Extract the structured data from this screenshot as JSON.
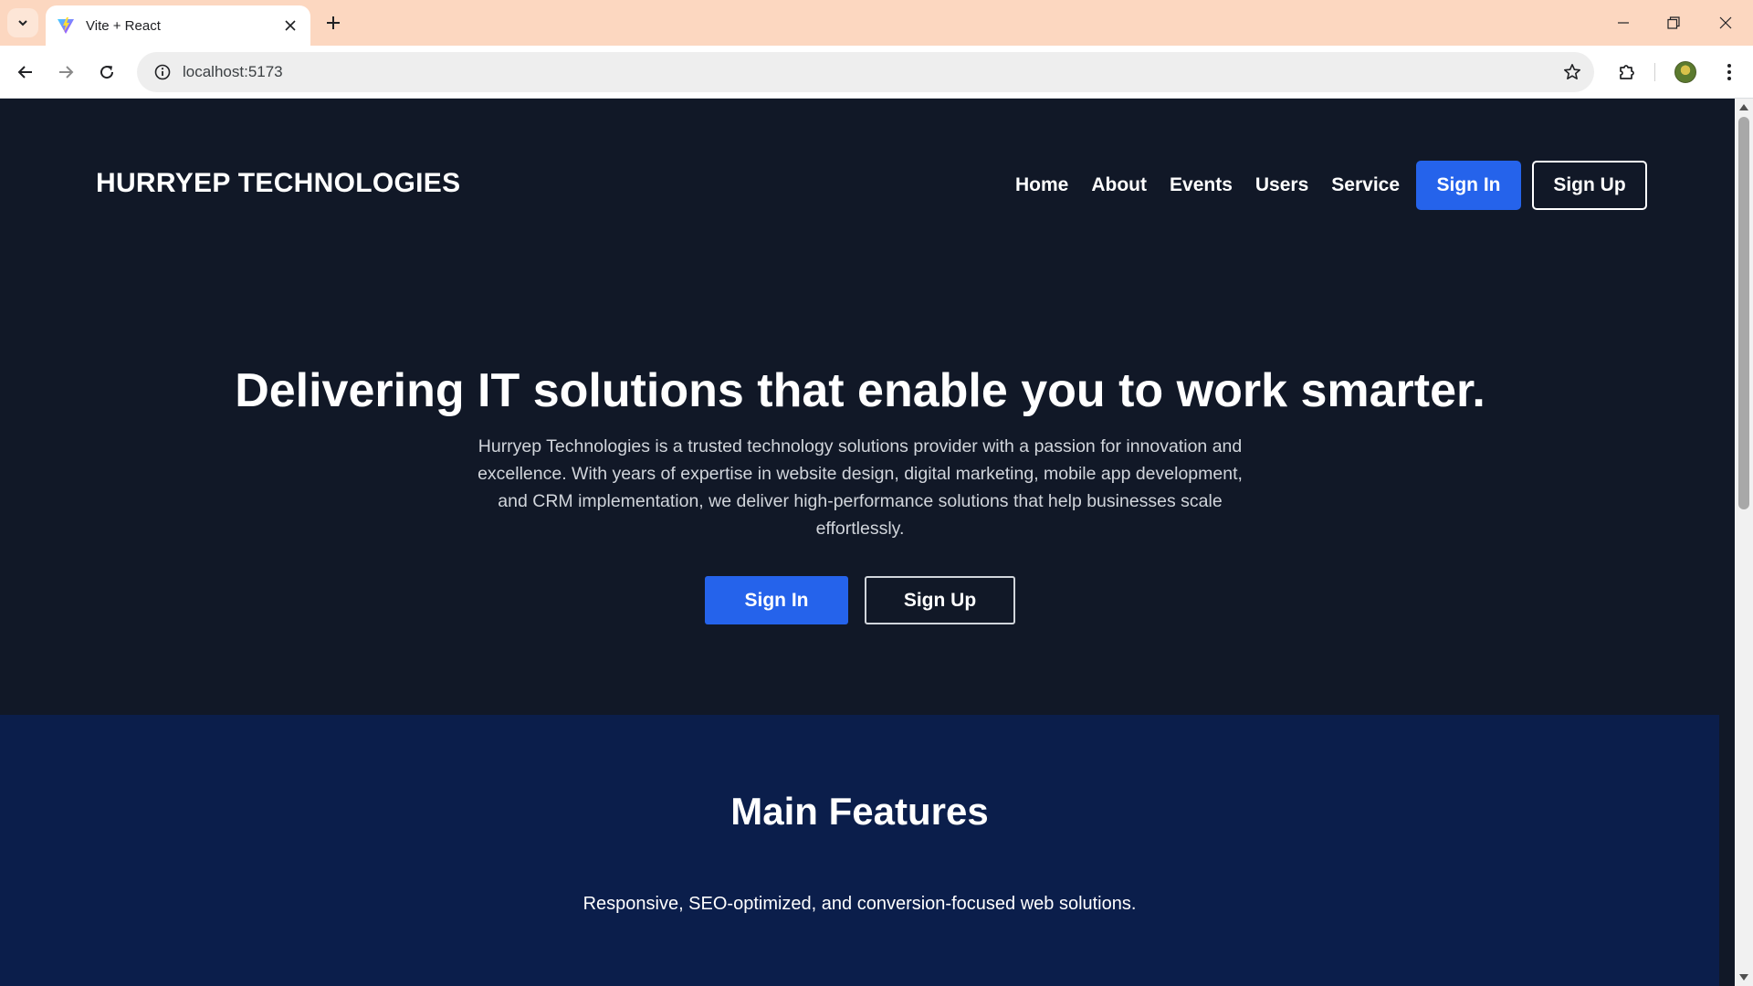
{
  "browser": {
    "tab_title": "Vite + React",
    "url": "localhost:5173"
  },
  "site": {
    "logo": "HURRYEP TECHNOLOGIES",
    "nav": [
      "Home",
      "About",
      "Events",
      "Users",
      "Service"
    ],
    "nav_signin": "Sign In",
    "nav_signup": "Sign Up"
  },
  "hero": {
    "title": "Delivering IT solutions that enable you to work smarter.",
    "description": "Hurryep Technologies is a trusted technology solutions provider with a passion for innovation and excellence. With years of expertise in website design, digital marketing, mobile app development, and CRM implementation, we deliver high-performance solutions that help businesses scale effortlessly.",
    "signin": "Sign In",
    "signup": "Sign Up"
  },
  "features": {
    "title": "Main Features",
    "text": "Responsive, SEO-optimized, and conversion-focused web solutions."
  },
  "colors": {
    "tabstrip": "#fcd7c0",
    "page_bg": "#111827",
    "features_bg": "#0b1e4b",
    "primary": "#2563eb"
  }
}
